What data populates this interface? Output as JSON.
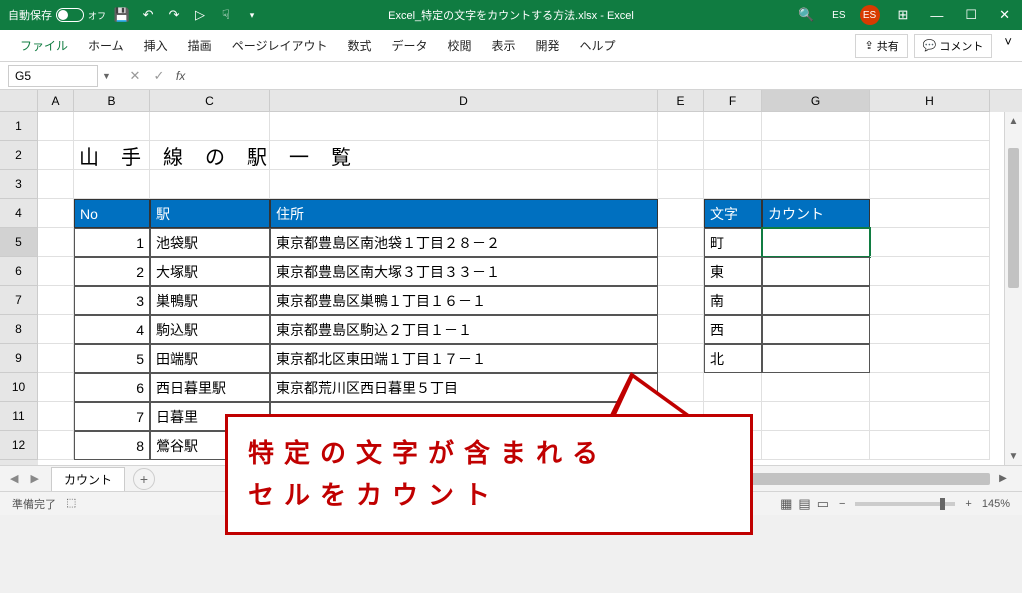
{
  "titlebar": {
    "autosave_label": "自動保存",
    "autosave_state": "オフ",
    "filename": "Excel_特定の文字をカウントする方法.xlsx - Excel",
    "user_initials": "ES"
  },
  "menu": {
    "file": "ファイル",
    "home": "ホーム",
    "insert": "挿入",
    "draw": "描画",
    "pagelayout": "ページレイアウト",
    "formulas": "数式",
    "data": "データ",
    "review": "校閲",
    "view": "表示",
    "developer": "開発",
    "help": "ヘルプ",
    "share": "共有",
    "comment": "コメント"
  },
  "formula_bar": {
    "name_box": "G5",
    "fx": "fx",
    "input": ""
  },
  "cols": [
    "A",
    "B",
    "C",
    "D",
    "E",
    "F",
    "G",
    "H"
  ],
  "rows": [
    "1",
    "2",
    "3",
    "4",
    "5",
    "6",
    "7",
    "8",
    "9",
    "10",
    "11",
    "12"
  ],
  "title_text": "山手線の駅一覧",
  "main_headers": {
    "no": "No",
    "station": "駅",
    "address": "住所"
  },
  "main_rows": [
    {
      "no": "1",
      "station": "池袋駅",
      "address": "東京都豊島区南池袋１丁目２８－２"
    },
    {
      "no": "2",
      "station": "大塚駅",
      "address": "東京都豊島区南大塚３丁目３３－１"
    },
    {
      "no": "3",
      "station": "巣鴨駅",
      "address": "東京都豊島区巣鴨１丁目１６－１"
    },
    {
      "no": "4",
      "station": "駒込駅",
      "address": "東京都豊島区駒込２丁目１－１"
    },
    {
      "no": "5",
      "station": "田端駅",
      "address": "東京都北区東田端１丁目１７－１"
    },
    {
      "no": "6",
      "station": "西日暮里駅",
      "address": "東京都荒川区西日暮里５丁目"
    },
    {
      "no": "7",
      "station": "日暮里",
      "address": ""
    },
    {
      "no": "8",
      "station": "鶯谷駅",
      "address": ""
    }
  ],
  "side_headers": {
    "char": "文字",
    "count": "カウント"
  },
  "side_rows": [
    "町",
    "東",
    "南",
    "西",
    "北"
  ],
  "sheet": {
    "name": "カウント"
  },
  "status": {
    "ready": "準備完了",
    "zoom": "145%"
  },
  "callout": {
    "line1": "特定の文字が含まれる",
    "line2": "セルをカウント"
  }
}
